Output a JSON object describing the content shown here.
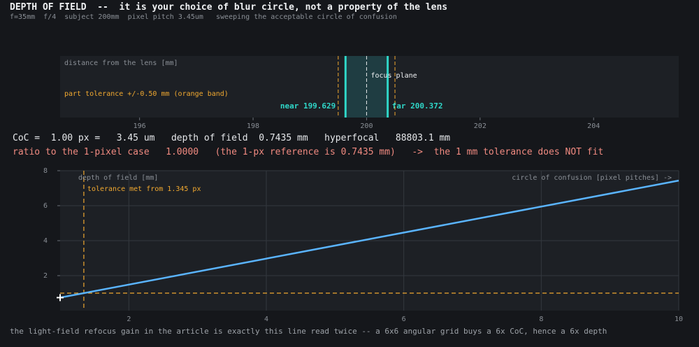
{
  "header": {
    "title": "DEPTH OF FIELD  --  it is your choice of blur circle, not a property of the lens",
    "subtitle": "f=35mm  f/4  subject 200mm  pixel pitch 3.45um   sweeping the acceptable circle of confusion"
  },
  "strip": {
    "axis_label": "distance from the lens [mm]",
    "focus_label": "focus plane",
    "tolerance_label": "part tolerance +/-0.50 mm (orange band)",
    "near_label": "near 199.629",
    "far_label": "far 200.372",
    "near": 199.629,
    "far": 200.372,
    "focus": 200,
    "tolerance": 0.5,
    "ticks": [
      196,
      198,
      200,
      202,
      204
    ],
    "xlim": [
      194.6,
      205.5
    ]
  },
  "readout": {
    "line1": "CoC =  1.00 px =   3.45 um   depth of field  0.7435 mm   hyperfocal   88803.1 mm",
    "line2": "ratio to the 1-pixel case   1.0000   (the 1-px reference is 0.7435 mm)   ->  the 1 mm tolerance does NOT fit"
  },
  "colors": {
    "line": "#5ab4ff",
    "orange": "#f0a830",
    "cyan": "#2fd6c8",
    "band": "#1f3d42"
  },
  "chart_data": {
    "type": "line",
    "title": "",
    "xlabel": "circle of confusion [pixel pitches] ->",
    "ylabel": "depth of field [mm]",
    "x": [
      1,
      10
    ],
    "series": [
      {
        "values": [
          0.7435,
          7.435
        ]
      }
    ],
    "xlim": [
      1,
      10
    ],
    "ylim": [
      0,
      8
    ],
    "xticks": [
      2,
      4,
      6,
      8,
      10
    ],
    "yticks": [
      2,
      4,
      6,
      8
    ],
    "grid": true,
    "tolerance_y": 1.0,
    "threshold_x": 1.345,
    "threshold_label": "tolerance met from 1.345 px",
    "marker": {
      "x": 1,
      "y": 0.7435
    }
  },
  "footer": "the light-field refocus gain in the article is exactly this line read twice -- a 6x6 angular grid buys a 6x CoC, hence a 6x depth"
}
